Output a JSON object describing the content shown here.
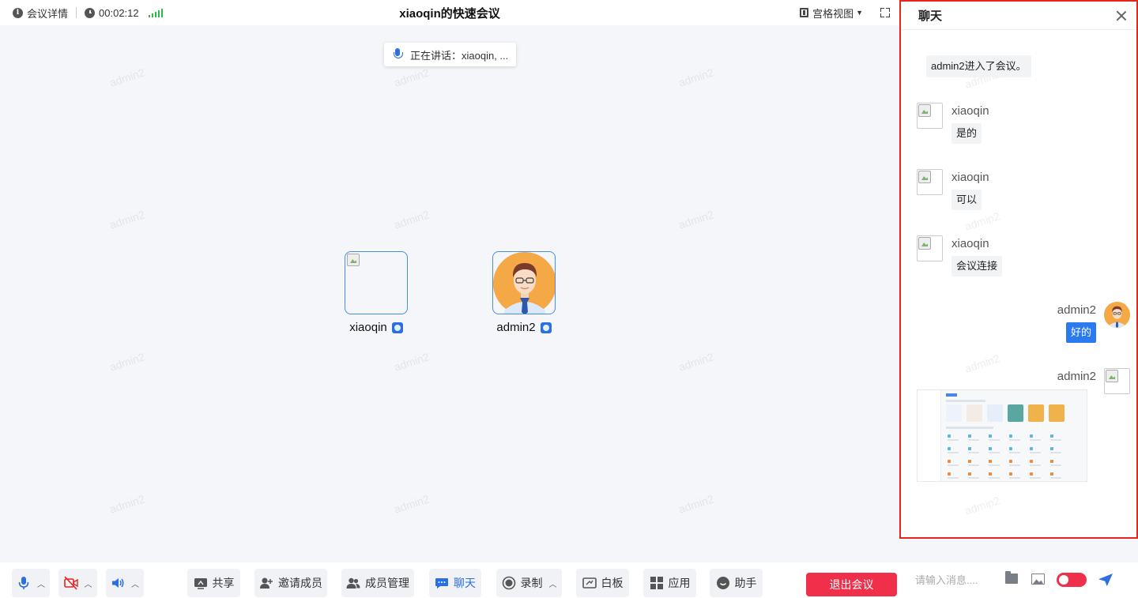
{
  "topbar": {
    "meeting_details": "会议详情",
    "elapsed": "00:02:12",
    "title": "xiaoqin的快速会议",
    "view_mode": "宫格视图"
  },
  "stage": {
    "watermark": "admin2",
    "active_speaker": "正在讲话：xiaoqin, ...",
    "participants": [
      {
        "name": "xiaoqin"
      },
      {
        "name": "admin2"
      }
    ]
  },
  "toolbar": {
    "share": "共享",
    "invite": "邀请成员",
    "members": "成员管理",
    "chat": "聊天",
    "record": "录制",
    "whiteboard": "白板",
    "apps": "应用",
    "assistant": "助手",
    "exit": "退出会议"
  },
  "chat": {
    "title": "聊天",
    "system_message": "admin2进入了会议。",
    "messages": [
      {
        "sender": "xiaoqin",
        "text": "是的"
      },
      {
        "sender": "xiaoqin",
        "text": "可以"
      },
      {
        "sender": "xiaoqin",
        "text": "会议连接"
      },
      {
        "sender": "admin2",
        "text": "好的"
      },
      {
        "sender": "admin2",
        "text": ""
      }
    ],
    "input_placeholder": "请输入消息...."
  },
  "colors": {
    "accent": "#2b6fe0",
    "danger": "#f0304a",
    "highlight_border": "#e8241e"
  },
  "icons": [
    "info-icon",
    "clock-icon",
    "signal-icon",
    "grid-view-icon",
    "fullscreen-icon",
    "microphone-icon",
    "camera-off-icon",
    "speaker-icon",
    "share-screen-icon",
    "add-user-icon",
    "members-icon",
    "chat-icon",
    "record-icon",
    "whiteboard-icon",
    "apps-icon",
    "assistant-icon",
    "close-icon",
    "folder-icon",
    "image-icon",
    "send-icon"
  ]
}
